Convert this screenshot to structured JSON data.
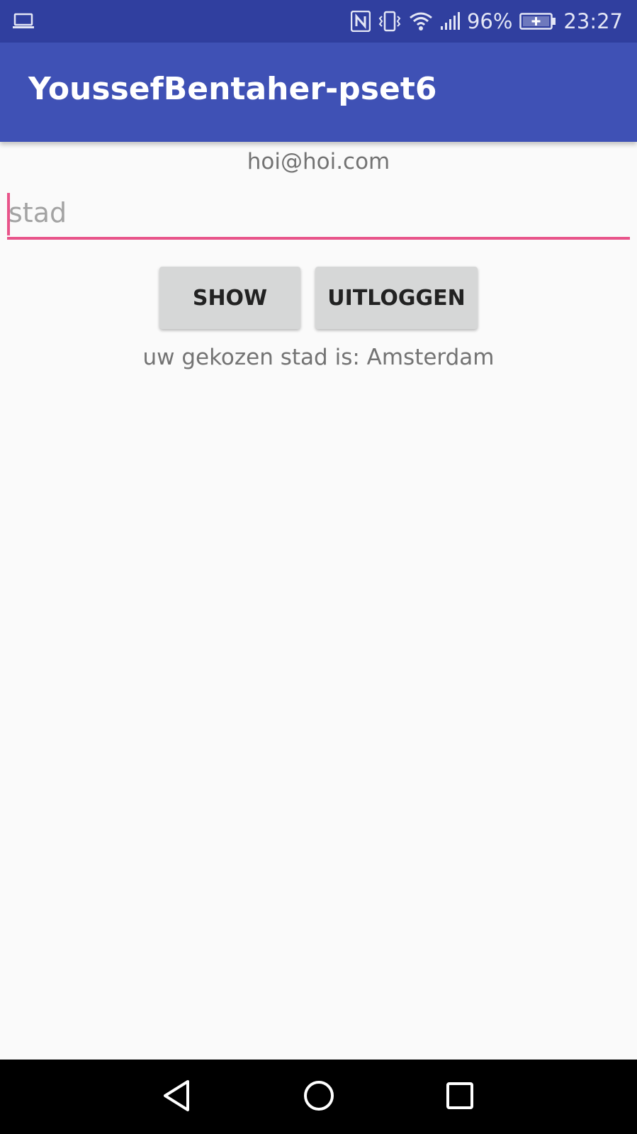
{
  "status_bar": {
    "left_icon": "laptop-icon",
    "icons": [
      "nfc-icon",
      "vibrate-icon",
      "wifi-icon",
      "signal-icon",
      "battery-charging-icon"
    ],
    "battery_percent": "96%",
    "time": "23:27"
  },
  "app_bar": {
    "title": "YoussefBentaher-pset6",
    "color": "#3f51b5"
  },
  "main": {
    "email": "hoi@hoi.com",
    "city_input": {
      "value": "",
      "placeholder": "stad",
      "accent_color": "#e8548a"
    },
    "show_button": "SHOW",
    "logout_button": "UITLOGGEN",
    "result_text": "uw gekozen stad is: Amsterdam"
  },
  "nav_bar": {
    "buttons": [
      "back-icon",
      "home-icon",
      "recents-icon"
    ]
  }
}
